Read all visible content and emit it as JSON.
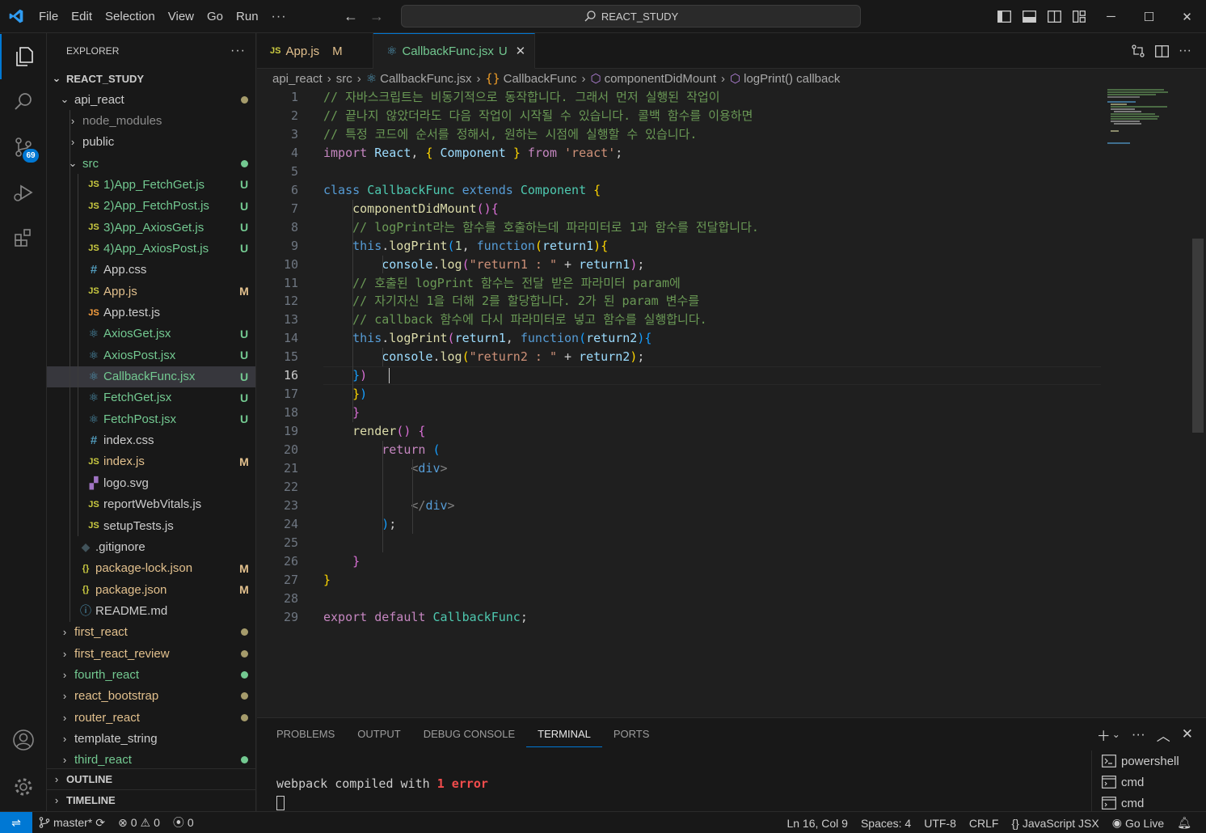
{
  "menu": [
    "File",
    "Edit",
    "Selection",
    "View",
    "Go",
    "Run",
    "···"
  ],
  "command_center": "REACT_STUDY",
  "explorer": {
    "title": "EXPLORER",
    "root": "REACT_STUDY",
    "rows": [
      {
        "label": "api_react",
        "indent": 1,
        "type": "folder-open",
        "status": "",
        "dot": "#a59b6b",
        "color": "#cccccc"
      },
      {
        "label": "node_modules",
        "indent": 2,
        "type": "folder",
        "status": "",
        "dot": "",
        "color": "#8c8c8c"
      },
      {
        "label": "public",
        "indent": 2,
        "type": "folder",
        "status": "",
        "dot": "",
        "color": "#cccccc"
      },
      {
        "label": "src",
        "indent": 2,
        "type": "folder-open",
        "status": "",
        "dot": "#73c991",
        "color": "#73c991"
      },
      {
        "label": "1)App_FetchGet.js",
        "indent": 3,
        "type": "js",
        "status": "U",
        "dot": "",
        "color": "#73c991"
      },
      {
        "label": "2)App_FetchPost.js",
        "indent": 3,
        "type": "js",
        "status": "U",
        "dot": "",
        "color": "#73c991"
      },
      {
        "label": "3)App_AxiosGet.js",
        "indent": 3,
        "type": "js",
        "status": "U",
        "dot": "",
        "color": "#73c991"
      },
      {
        "label": "4)App_AxiosPost.js",
        "indent": 3,
        "type": "js",
        "status": "U",
        "dot": "",
        "color": "#73c991"
      },
      {
        "label": "App.css",
        "indent": 3,
        "type": "css",
        "status": "",
        "dot": "",
        "color": "#cccccc"
      },
      {
        "label": "App.js",
        "indent": 3,
        "type": "js",
        "status": "M",
        "dot": "",
        "color": "#e2c08d"
      },
      {
        "label": "App.test.js",
        "indent": 3,
        "type": "test",
        "status": "",
        "dot": "",
        "color": "#cccccc"
      },
      {
        "label": "AxiosGet.jsx",
        "indent": 3,
        "type": "jsx",
        "status": "U",
        "dot": "",
        "color": "#73c991"
      },
      {
        "label": "AxiosPost.jsx",
        "indent": 3,
        "type": "jsx",
        "status": "U",
        "dot": "",
        "color": "#73c991"
      },
      {
        "label": "CallbackFunc.jsx",
        "indent": 3,
        "type": "jsx",
        "status": "U",
        "dot": "",
        "color": "#73c991",
        "selected": true
      },
      {
        "label": "FetchGet.jsx",
        "indent": 3,
        "type": "jsx",
        "status": "U",
        "dot": "",
        "color": "#73c991"
      },
      {
        "label": "FetchPost.jsx",
        "indent": 3,
        "type": "jsx",
        "status": "U",
        "dot": "",
        "color": "#73c991"
      },
      {
        "label": "index.css",
        "indent": 3,
        "type": "css",
        "status": "",
        "dot": "",
        "color": "#cccccc"
      },
      {
        "label": "index.js",
        "indent": 3,
        "type": "js",
        "status": "M",
        "dot": "",
        "color": "#e2c08d"
      },
      {
        "label": "logo.svg",
        "indent": 3,
        "type": "svg",
        "status": "",
        "dot": "",
        "color": "#cccccc"
      },
      {
        "label": "reportWebVitals.js",
        "indent": 3,
        "type": "js",
        "status": "",
        "dot": "",
        "color": "#cccccc"
      },
      {
        "label": "setupTests.js",
        "indent": 3,
        "type": "js",
        "status": "",
        "dot": "",
        "color": "#cccccc"
      },
      {
        "label": ".gitignore",
        "indent": 2,
        "type": "git",
        "status": "",
        "dot": "",
        "color": "#cccccc"
      },
      {
        "label": "package-lock.json",
        "indent": 2,
        "type": "json",
        "status": "M",
        "dot": "",
        "color": "#e2c08d"
      },
      {
        "label": "package.json",
        "indent": 2,
        "type": "json",
        "status": "M",
        "dot": "",
        "color": "#e2c08d"
      },
      {
        "label": "README.md",
        "indent": 2,
        "type": "info",
        "status": "",
        "dot": "",
        "color": "#cccccc"
      },
      {
        "label": "first_react",
        "indent": 1,
        "type": "folder",
        "status": "",
        "dot": "#a59b6b",
        "color": "#e2c08d"
      },
      {
        "label": "first_react_review",
        "indent": 1,
        "type": "folder",
        "status": "",
        "dot": "#a59b6b",
        "color": "#e2c08d"
      },
      {
        "label": "fourth_react",
        "indent": 1,
        "type": "folder",
        "status": "",
        "dot": "#73c991",
        "color": "#73c991"
      },
      {
        "label": "react_bootstrap",
        "indent": 1,
        "type": "folder",
        "status": "",
        "dot": "#a59b6b",
        "color": "#e2c08d"
      },
      {
        "label": "router_react",
        "indent": 1,
        "type": "folder",
        "status": "",
        "dot": "#a59b6b",
        "color": "#e2c08d"
      },
      {
        "label": "template_string",
        "indent": 1,
        "type": "folder",
        "status": "",
        "dot": "",
        "color": "#cccccc"
      },
      {
        "label": "third_react",
        "indent": 1,
        "type": "folder",
        "status": "",
        "dot": "#73c991",
        "color": "#73c991"
      }
    ],
    "outline": "OUTLINE",
    "timeline": "TIMELINE"
  },
  "source_control_badge": "69",
  "tabs": [
    {
      "icon": "JS",
      "label": "App.js",
      "status": "M",
      "active": false,
      "color": "#e2c08d"
    },
    {
      "icon": "⚛",
      "label": "CallbackFunc.jsx",
      "status": "U",
      "active": true,
      "color": "#73c991"
    }
  ],
  "breadcrumb": [
    "api_react",
    "src",
    "CallbackFunc.jsx",
    "CallbackFunc",
    "componentDidMount",
    "logPrint() callback"
  ],
  "code_lines": [
    [
      [
        "cmt",
        "// 자바스크립트는 비동기적으로 동작합니다. 그래서 먼저 실행된 작업이"
      ]
    ],
    [
      [
        "cmt",
        "// 끝나지 않았더라도 다음 작업이 시작될 수 있습니다. 콜백 함수를 이용하면"
      ]
    ],
    [
      [
        "cmt",
        "// 특정 코드에 순서를 정해서, 원하는 시점에 실행할 수 있습니다."
      ]
    ],
    [
      [
        "kw2",
        "import"
      ],
      [
        "",
        " "
      ],
      [
        "var",
        "React"
      ],
      [
        "",
        ", "
      ],
      [
        "b1",
        "{"
      ],
      [
        "",
        " "
      ],
      [
        "var",
        "Component"
      ],
      [
        "",
        " "
      ],
      [
        "b1",
        "}"
      ],
      [
        "",
        " "
      ],
      [
        "kw2",
        "from"
      ],
      [
        "",
        " "
      ],
      [
        "str",
        "'react'"
      ],
      [
        "",
        ";"
      ]
    ],
    [],
    [
      [
        "kw",
        "class"
      ],
      [
        "",
        " "
      ],
      [
        "cls",
        "CallbackFunc"
      ],
      [
        "",
        " "
      ],
      [
        "kw",
        "extends"
      ],
      [
        "",
        " "
      ],
      [
        "cls",
        "Component"
      ],
      [
        "",
        " "
      ],
      [
        "b1",
        "{"
      ]
    ],
    [
      [
        "",
        "    "
      ],
      [
        "fn",
        "componentDidMount"
      ],
      [
        "b2",
        "()"
      ],
      [
        "b2",
        "{"
      ]
    ],
    [
      [
        "",
        "    "
      ],
      [
        "cmt",
        "// logPrint라는 함수를 호출하는데 파라미터로 1과 함수를 전달합니다."
      ]
    ],
    [
      [
        "",
        "    "
      ],
      [
        "kw",
        "this"
      ],
      [
        "",
        "."
      ],
      [
        "fn",
        "logPrint"
      ],
      [
        "b3",
        "("
      ],
      [
        "num",
        "1"
      ],
      [
        "",
        ", "
      ],
      [
        "kw",
        "function"
      ],
      [
        "b1",
        "("
      ],
      [
        "var",
        "return1"
      ],
      [
        "b1",
        ")"
      ],
      [
        "b1",
        "{"
      ]
    ],
    [
      [
        "",
        "        "
      ],
      [
        "var",
        "console"
      ],
      [
        "",
        "."
      ],
      [
        "fn",
        "log"
      ],
      [
        "b2",
        "("
      ],
      [
        "str",
        "\"return1 : \""
      ],
      [
        "",
        " + "
      ],
      [
        "var",
        "return1"
      ],
      [
        "b2",
        ")"
      ],
      [
        "",
        ";"
      ]
    ],
    [
      [
        "",
        "    "
      ],
      [
        "cmt",
        "// 호출된 logPrint 함수는 전달 받은 파라미터 param에"
      ]
    ],
    [
      [
        "",
        "    "
      ],
      [
        "cmt",
        "// 자기자신 1을 더해 2를 할당합니다. 2가 된 param 변수를"
      ]
    ],
    [
      [
        "",
        "    "
      ],
      [
        "cmt",
        "// callback 함수에 다시 파라미터로 넣고 함수를 실행합니다."
      ]
    ],
    [
      [
        "",
        "    "
      ],
      [
        "kw",
        "this"
      ],
      [
        "",
        "."
      ],
      [
        "fn",
        "logPrint"
      ],
      [
        "b2",
        "("
      ],
      [
        "var",
        "return1"
      ],
      [
        "",
        ", "
      ],
      [
        "kw",
        "function"
      ],
      [
        "b3",
        "("
      ],
      [
        "var",
        "return2"
      ],
      [
        "b3",
        ")"
      ],
      [
        "b3",
        "{"
      ]
    ],
    [
      [
        "",
        "        "
      ],
      [
        "var",
        "console"
      ],
      [
        "",
        "."
      ],
      [
        "fn",
        "log"
      ],
      [
        "b1",
        "("
      ],
      [
        "str",
        "\"return2 : \""
      ],
      [
        "",
        " + "
      ],
      [
        "var",
        "return2"
      ],
      [
        "b1",
        ")"
      ],
      [
        "",
        ";"
      ]
    ],
    [
      [
        "",
        "    "
      ],
      [
        "b3",
        "}"
      ],
      [
        "b2",
        ")"
      ]
    ],
    [
      [
        "",
        "    "
      ],
      [
        "b1",
        "}"
      ],
      [
        "b3",
        ")"
      ]
    ],
    [
      [
        "",
        "    "
      ],
      [
        "b2",
        "}"
      ]
    ],
    [
      [
        "",
        "    "
      ],
      [
        "fn",
        "render"
      ],
      [
        "b2",
        "()"
      ],
      [
        "",
        " "
      ],
      [
        "b2",
        "{"
      ]
    ],
    [
      [
        "",
        "        "
      ],
      [
        "kw2",
        "return"
      ],
      [
        "",
        " "
      ],
      [
        "b3",
        "("
      ]
    ],
    [
      [
        "",
        "            "
      ],
      [
        "tag",
        "<"
      ],
      [
        "tagn",
        "div"
      ],
      [
        "tag",
        ">"
      ]
    ],
    [],
    [
      [
        "",
        "            "
      ],
      [
        "tag",
        "</"
      ],
      [
        "tagn",
        "div"
      ],
      [
        "tag",
        ">"
      ]
    ],
    [
      [
        "",
        "        "
      ],
      [
        "b3",
        ")"
      ],
      [
        "",
        ";"
      ]
    ],
    [],
    [
      [
        "",
        "    "
      ],
      [
        "b2",
        "}"
      ]
    ],
    [
      [
        "b1",
        "}"
      ]
    ],
    [],
    [
      [
        "kw2",
        "export"
      ],
      [
        "",
        " "
      ],
      [
        "kw2",
        "default"
      ],
      [
        "",
        " "
      ],
      [
        "cls",
        "CallbackFunc"
      ],
      [
        "",
        ";"
      ]
    ]
  ],
  "current_line": 16,
  "panel": {
    "tabs": [
      "PROBLEMS",
      "OUTPUT",
      "DEBUG CONSOLE",
      "TERMINAL",
      "PORTS"
    ],
    "active_tab": "TERMINAL",
    "terminal_text": "webpack compiled with ",
    "terminal_error_count": "1",
    "terminal_error_word": "error",
    "shells": [
      "powershell",
      "cmd",
      "cmd"
    ]
  },
  "status": {
    "branch": "master*",
    "errors": "0",
    "warnings": "0",
    "ports": "0",
    "position": "Ln 16, Col 9",
    "spaces": "Spaces: 4",
    "encoding": "UTF-8",
    "eol": "CRLF",
    "language": "JavaScript JSX",
    "golive": "Go Live"
  }
}
